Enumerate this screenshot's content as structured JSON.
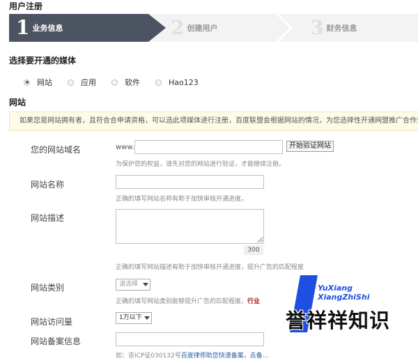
{
  "page": {
    "title": "用户注册"
  },
  "steps": [
    {
      "num": "1",
      "label": "业务信息"
    },
    {
      "num": "2",
      "label": "创建用户"
    },
    {
      "num": "3",
      "label": "财务信息"
    }
  ],
  "media": {
    "title": "选择要开通的媒体",
    "options": [
      "网站",
      "应用",
      "软件",
      "Hao123"
    ],
    "selected": "网站"
  },
  "website": {
    "section_title": "网站",
    "notice": "如果您是网站拥有者，且符合合申请资格，可以选此项媒体进行注册，百度联盟会根据网站的情况，为您选择性开通网盟推广合作业务与",
    "domain": {
      "label": "您的网站域名",
      "prefix": "www.",
      "value": "",
      "button": "开始验证网站",
      "hint": "为保护您的权益，请先对您的网站进行验证，才能继续注册。"
    },
    "name": {
      "label": "网站名称",
      "value": "",
      "hint": "正确的填写网站名称有助于加快审核开通进度。"
    },
    "desc": {
      "label": "网站描述",
      "value": "",
      "counter": "300",
      "hint": "正确的填写网站描述有助于加快审核开通进度，提升广告的匹配程度"
    },
    "category": {
      "label": "网站类别",
      "selected": "请选择",
      "hint": "正确的填写网站类别能够提升广告的匹配程度。",
      "hint_red": "行业"
    },
    "traffic": {
      "label": "网站访问量",
      "selected": "1万以下"
    },
    "icp": {
      "label": "网站备案信息",
      "value": "",
      "hint_prefix": "如：京ICP证030132号",
      "hint_link": "百度律师助您快速备案，去备..."
    }
  },
  "watermark": {
    "en_line1": "YuXiang",
    "en_line2": "XiangZhiShi",
    "cn": "誉祥祥知识",
    "color": "#1f4fe0"
  }
}
